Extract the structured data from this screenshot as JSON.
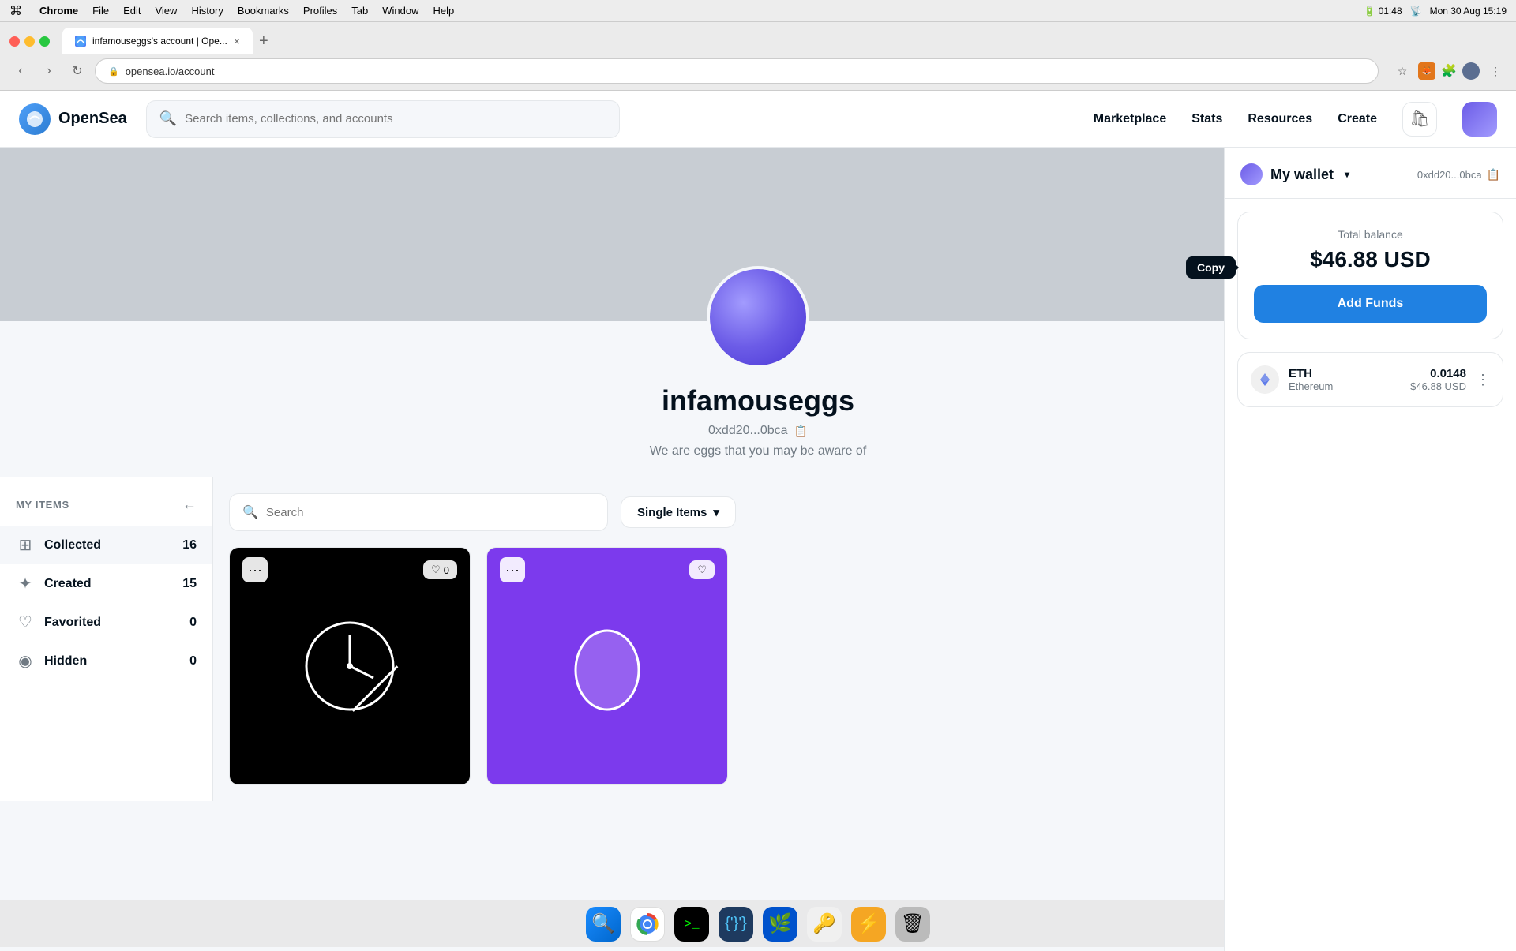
{
  "macos": {
    "menubar": {
      "apple": "⌘",
      "app": "Chrome",
      "menus": [
        "File",
        "Edit",
        "View",
        "History",
        "Bookmarks",
        "Profiles",
        "Tab",
        "Window",
        "Help"
      ],
      "battery_icon": "🔋",
      "time": "Mon 30 Aug  15:19",
      "wifi": "📶"
    }
  },
  "browser": {
    "tab_title": "infamouseggs's account | Ope...",
    "url": "opensea.io/account",
    "new_tab_label": "+"
  },
  "nav": {
    "logo_text": "OpenSea",
    "search_placeholder": "Search items, collections, and accounts",
    "links": {
      "marketplace": "Marketplace",
      "stats": "Stats",
      "resources": "Resources",
      "create": "Create"
    }
  },
  "profile": {
    "username": "infamouseggs",
    "address": "0xdd20...0bca",
    "address_full": "0xdd20...0bca",
    "bio": "We are eggs that you may be aware of"
  },
  "sidebar": {
    "header": "MY ITEMS",
    "items": [
      {
        "id": "collected",
        "label": "Collected",
        "count": "16",
        "active": true
      },
      {
        "id": "created",
        "label": "Created",
        "count": "15",
        "active": false
      },
      {
        "id": "favorited",
        "label": "Favorited",
        "count": "0",
        "active": false
      },
      {
        "id": "hidden",
        "label": "Hidden",
        "count": "0",
        "active": false
      }
    ]
  },
  "items_toolbar": {
    "search_placeholder": "Search",
    "filter_btn": "Single Items"
  },
  "wallet": {
    "title": "My wallet",
    "address": "0xdd20...0bca",
    "balance_label": "Total balance",
    "balance": "$46.88 USD",
    "add_funds_label": "Add Funds",
    "eth": {
      "name": "ETH",
      "subname": "Ethereum",
      "amount": "0.0148",
      "usd": "$46.88 USD"
    }
  },
  "copy_tooltip": "Copy",
  "nft_cards": [
    {
      "id": "card1",
      "style": "black",
      "likes": "0"
    },
    {
      "id": "card2",
      "style": "purple",
      "likes": ""
    }
  ],
  "dock": {
    "icons": [
      "🔍",
      "🌐",
      ">_",
      "💙",
      "🌿",
      "🔑",
      "⚡",
      "🗑️"
    ]
  }
}
